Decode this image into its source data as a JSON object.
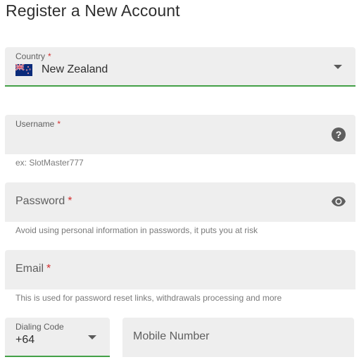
{
  "page": {
    "title": "Register a New Account"
  },
  "country": {
    "label": "Country",
    "required": "*",
    "value": "New Zealand",
    "flag_icon": "new-zealand-flag-icon",
    "arrow_icon": "dropdown-arrow-icon"
  },
  "username": {
    "label": "Username",
    "required": "*",
    "value": "",
    "helper": "ex: SlotMaster777",
    "icon": "help-icon"
  },
  "password": {
    "label": "Password",
    "required": "*",
    "value": "",
    "helper": "Avoid using personal information in passwords, it puts you at risk",
    "icon": "eye-icon"
  },
  "email": {
    "label": "Email",
    "required": "*",
    "value": "",
    "helper": "This is used for password reset links, withdrawals processing and more"
  },
  "dialing_code": {
    "label": "Dialing Code",
    "value": "+64",
    "arrow_icon": "dropdown-arrow-icon"
  },
  "mobile": {
    "label": "Mobile Number",
    "value": ""
  },
  "colors": {
    "accent_green": "#43a047",
    "required_red": "#d32f2f",
    "field_bg": "#eeeeee"
  }
}
